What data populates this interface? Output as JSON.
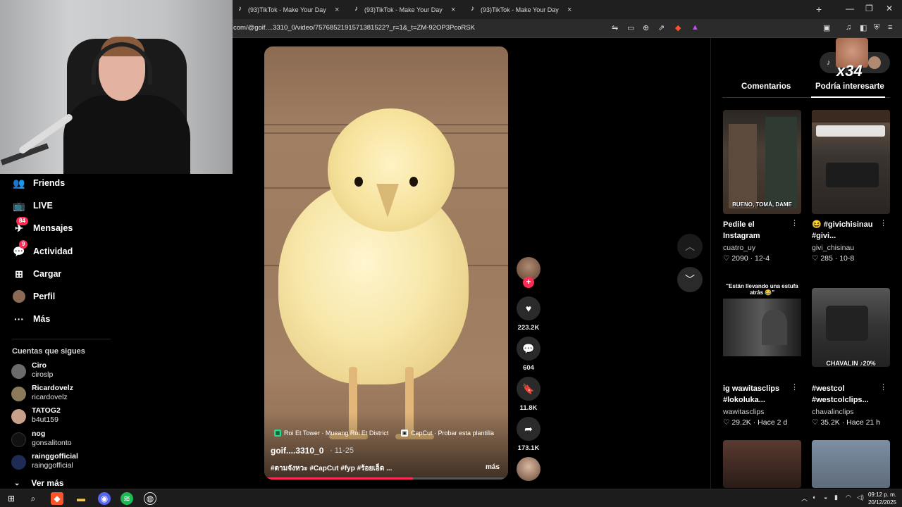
{
  "browser": {
    "tabs": [
      {
        "title": "(93)TikTok - Make Your Day"
      },
      {
        "title": "(93)TikTok - Make Your Day"
      },
      {
        "title": "(93)TikTok - Make Your Day"
      }
    ],
    "new_tab_label": "+",
    "url": "com/@goif....3310_0/video/7576852191571381522?_r=1&_t=ZM-92OP3PcoRSK"
  },
  "sidebar": {
    "items": [
      {
        "label": "Friends",
        "icon": "friends-icon"
      },
      {
        "label": "LIVE",
        "icon": "live-icon"
      },
      {
        "label": "Mensajes",
        "icon": "messages-icon",
        "badge": "84"
      },
      {
        "label": "Actividad",
        "icon": "activity-icon",
        "badge": "9"
      },
      {
        "label": "Cargar",
        "icon": "upload-icon"
      },
      {
        "label": "Perfil",
        "icon": "profile-icon"
      },
      {
        "label": "Más",
        "icon": "more-icon"
      }
    ],
    "following_title": "Cuentas que sigues",
    "accounts": [
      {
        "name": "Ciro",
        "username": "ciroslp"
      },
      {
        "name": "Ricardovelz",
        "username": "ricardovelz"
      },
      {
        "name": "TATOG2",
        "username": "b4ut159"
      },
      {
        "name": "nog",
        "username": "gonsalitonto"
      },
      {
        "name": "rainggofficial",
        "username": "rainggofficial"
      }
    ],
    "see_more": "Ver más"
  },
  "video": {
    "location_tag": "Roi Et Tower · Mueang Roi Et District",
    "template_tag": "CapCut · Probar esta plantilla",
    "author": "goif....3310_0",
    "date": "· 11-25",
    "caption": "#ตามจังหวะ #CapCut #fyp #ร้อยเอ็ด ...",
    "more_label": "más",
    "progress_fraction": 0.61
  },
  "actions": {
    "follow_label": "+",
    "likes": "223.2K",
    "comments": "604",
    "saves": "11.8K",
    "shares": "173.1K"
  },
  "right_panel": {
    "emote_count": "x34",
    "tabs": [
      {
        "label": "Comentarios",
        "active": false
      },
      {
        "label": "Podría interesarte",
        "active": true
      }
    ],
    "cards": [
      {
        "title": "Pedile el Instagram",
        "user": "cuatro_uy",
        "likes": "2090",
        "date": "12-4",
        "overlay": "BUENO, TOMÁ, DAME"
      },
      {
        "title": "😆 #givichisinau #givi...",
        "user": "givi_chisinau",
        "likes": "285",
        "date": "10-8",
        "overlay": ""
      },
      {
        "title": "ig wawitasclips #lokoluka...",
        "user": "wawitasclips",
        "likes": "29.2K",
        "date": "Hace 2 d",
        "overlay": "\"Están llevando una estufa atrás 😂\""
      },
      {
        "title": "#westcol #westcolclips...",
        "user": "chavalinclips",
        "likes": "35.2K",
        "date": "Hace 21 h",
        "overlay": "CHAVALIN ♪20%"
      }
    ]
  },
  "taskbar": {
    "time": "09:12 p. m.",
    "date": "20/12/2025"
  },
  "colors": {
    "accent": "#fe2c55",
    "background": "#000000",
    "chrome": "#1f1f1f"
  }
}
